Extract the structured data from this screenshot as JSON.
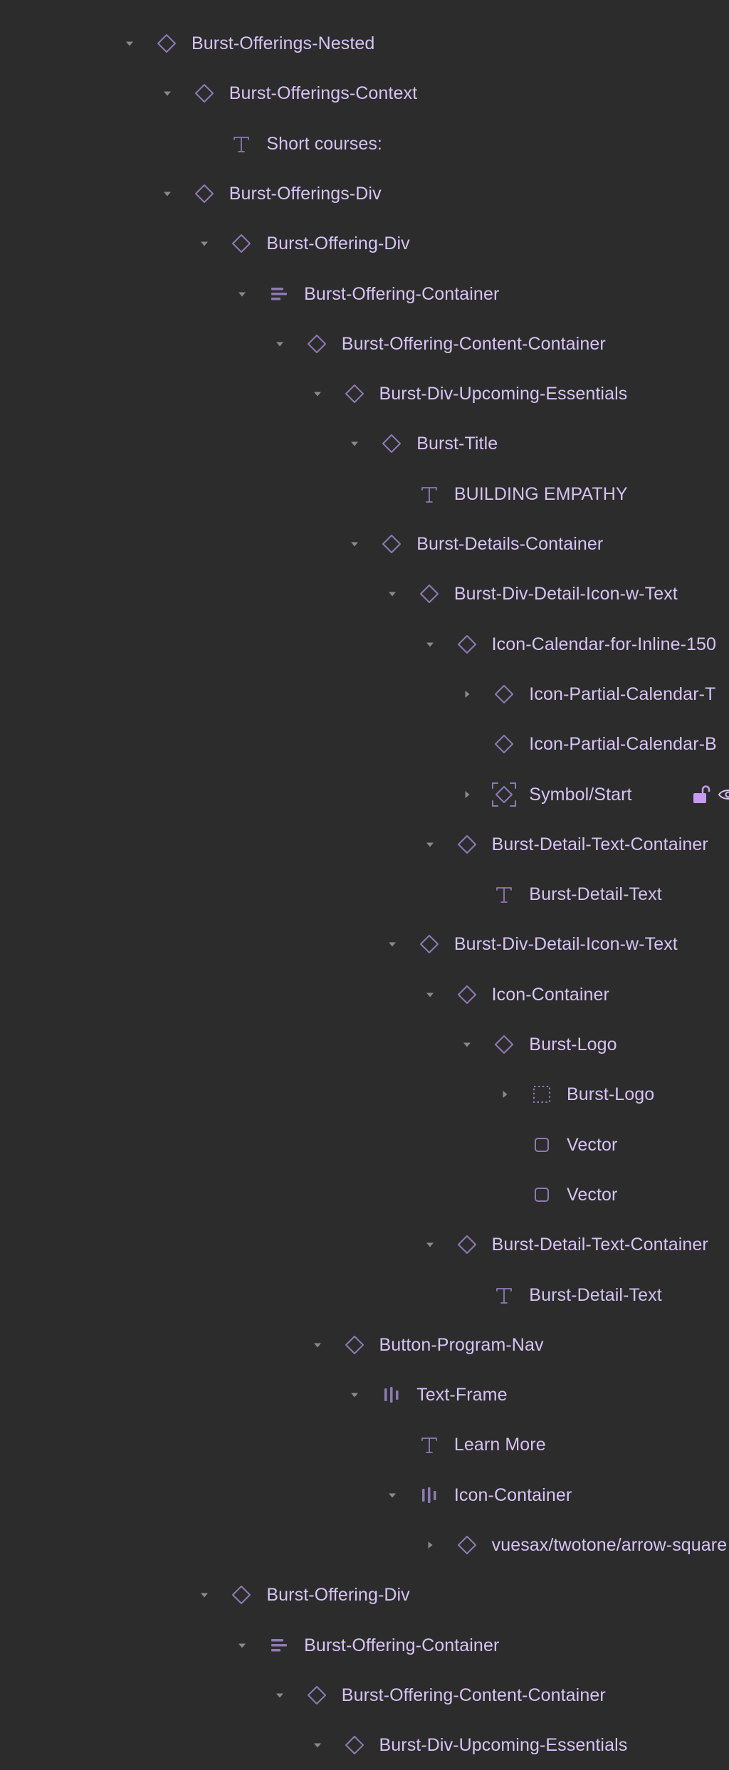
{
  "panel": "layers",
  "colors": {
    "background": "#2c2c2c",
    "label": "#d7c4f5",
    "icon": "#8f7ab5",
    "chevron": "#8a8a8a",
    "lock_icon": "#c79bf2"
  },
  "rows": [
    {
      "label": "Burst-Offerings-Nested",
      "depth": 0,
      "chevron": "expanded",
      "icon": "component-diamond-icon"
    },
    {
      "label": "Burst-Offerings-Context",
      "depth": 1,
      "chevron": "expanded",
      "icon": "component-diamond-icon"
    },
    {
      "label": "Short courses:",
      "depth": 2,
      "chevron": "none",
      "icon": "text-icon"
    },
    {
      "label": "Burst-Offerings-Div",
      "depth": 1,
      "chevron": "expanded",
      "icon": "component-diamond-icon"
    },
    {
      "label": "Burst-Offering-Div",
      "depth": 2,
      "chevron": "expanded",
      "icon": "component-diamond-icon"
    },
    {
      "label": "Burst-Offering-Container",
      "depth": 3,
      "chevron": "expanded",
      "icon": "auto-layout-vertical-icon"
    },
    {
      "label": "Burst-Offering-Content-Container",
      "depth": 4,
      "chevron": "expanded",
      "icon": "component-diamond-icon"
    },
    {
      "label": "Burst-Div-Upcoming-Essentials",
      "depth": 5,
      "chevron": "expanded",
      "icon": "component-diamond-icon"
    },
    {
      "label": "Burst-Title",
      "depth": 6,
      "chevron": "expanded",
      "icon": "component-diamond-icon"
    },
    {
      "label": "BUILDING EMPATHY",
      "depth": 7,
      "chevron": "none",
      "icon": "text-icon"
    },
    {
      "label": "Burst-Details-Container",
      "depth": 6,
      "chevron": "expanded",
      "icon": "component-diamond-icon"
    },
    {
      "label": "Burst-Div-Detail-Icon-w-Text",
      "depth": 7,
      "chevron": "expanded",
      "icon": "component-diamond-icon"
    },
    {
      "label": "Icon-Calendar-for-Inline-150",
      "depth": 8,
      "chevron": "expanded",
      "icon": "component-diamond-icon"
    },
    {
      "label": "Icon-Partial-Calendar-T",
      "depth": 9,
      "chevron": "collapsed",
      "icon": "component-diamond-icon"
    },
    {
      "label": "Icon-Partial-Calendar-B",
      "depth": 9,
      "chevron": "none",
      "icon": "component-diamond-icon"
    },
    {
      "label": "Symbol/Start",
      "depth": 9,
      "chevron": "collapsed",
      "icon": "component-frame-icon",
      "trailing": [
        "unlock-icon",
        "eye-icon"
      ]
    },
    {
      "label": "Burst-Detail-Text-Container",
      "depth": 8,
      "chevron": "expanded",
      "icon": "component-diamond-icon"
    },
    {
      "label": "Burst-Detail-Text",
      "depth": 9,
      "chevron": "none",
      "icon": "text-icon"
    },
    {
      "label": "Burst-Div-Detail-Icon-w-Text",
      "depth": 7,
      "chevron": "expanded",
      "icon": "component-diamond-icon"
    },
    {
      "label": "Icon-Container",
      "depth": 8,
      "chevron": "expanded",
      "icon": "component-diamond-icon"
    },
    {
      "label": "Burst-Logo",
      "depth": 9,
      "chevron": "expanded",
      "icon": "component-diamond-icon"
    },
    {
      "label": "Burst-Logo",
      "depth": 10,
      "chevron": "collapsed",
      "icon": "group-dotted-icon"
    },
    {
      "label": "Vector",
      "depth": 10,
      "chevron": "none",
      "icon": "vector-rect-icon"
    },
    {
      "label": "Vector",
      "depth": 10,
      "chevron": "none",
      "icon": "vector-rect-icon"
    },
    {
      "label": "Burst-Detail-Text-Container",
      "depth": 8,
      "chevron": "expanded",
      "icon": "component-diamond-icon"
    },
    {
      "label": "Burst-Detail-Text",
      "depth": 9,
      "chevron": "none",
      "icon": "text-icon"
    },
    {
      "label": "Button-Program-Nav",
      "depth": 5,
      "chevron": "expanded",
      "icon": "component-diamond-icon"
    },
    {
      "label": "Text-Frame",
      "depth": 6,
      "chevron": "expanded",
      "icon": "auto-layout-horizontal-icon"
    },
    {
      "label": "Learn More",
      "depth": 7,
      "chevron": "none",
      "icon": "text-icon"
    },
    {
      "label": "Icon-Container",
      "depth": 7,
      "chevron": "expanded",
      "icon": "auto-layout-horizontal-icon"
    },
    {
      "label": "vuesax/twotone/arrow-square",
      "depth": 8,
      "chevron": "collapsed",
      "icon": "component-diamond-icon"
    },
    {
      "label": "Burst-Offering-Div",
      "depth": 2,
      "chevron": "expanded",
      "icon": "component-diamond-icon"
    },
    {
      "label": "Burst-Offering-Container",
      "depth": 3,
      "chevron": "expanded",
      "icon": "auto-layout-vertical-icon"
    },
    {
      "label": "Burst-Offering-Content-Container",
      "depth": 4,
      "chevron": "expanded",
      "icon": "component-diamond-icon"
    },
    {
      "label": "Burst-Div-Upcoming-Essentials",
      "depth": 5,
      "chevron": "expanded",
      "icon": "component-diamond-icon"
    }
  ]
}
